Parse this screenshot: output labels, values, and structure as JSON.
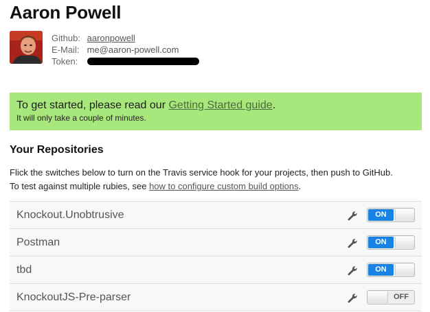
{
  "profile": {
    "name": "Aaron Powell",
    "fields": [
      {
        "label": "Github:",
        "value": "aaronpowell",
        "is_link": true
      },
      {
        "label": "E-Mail:",
        "value": "me@aaron-powell.com",
        "is_link": false
      },
      {
        "label": "Token:",
        "value": "",
        "redacted": true
      }
    ]
  },
  "notice": {
    "line1_prefix": "To get started, please read our ",
    "line1_link": "Getting Started guide",
    "line1_suffix": ".",
    "line2": "It will only take a couple of minutes.",
    "background_color": "#a8e77b"
  },
  "repositories": {
    "heading": "Your Repositories",
    "desc_line1": "Flick the switches below to turn on the Travis service hook for your projects, then push to GitHub.",
    "desc_line2_prefix": "To test against multiple rubies, see ",
    "desc_line2_link": "how to configure custom build options",
    "desc_line2_suffix": ".",
    "items": [
      {
        "name": "Knockout.Unobtrusive",
        "state": "ON"
      },
      {
        "name": "Postman",
        "state": "ON"
      },
      {
        "name": "tbd",
        "state": "ON"
      },
      {
        "name": "KnockoutJS-Pre-parser",
        "state": "OFF"
      }
    ]
  },
  "colors": {
    "toggle_on": "#1a82e2"
  },
  "icons": {
    "settings": "wrench-icon"
  }
}
